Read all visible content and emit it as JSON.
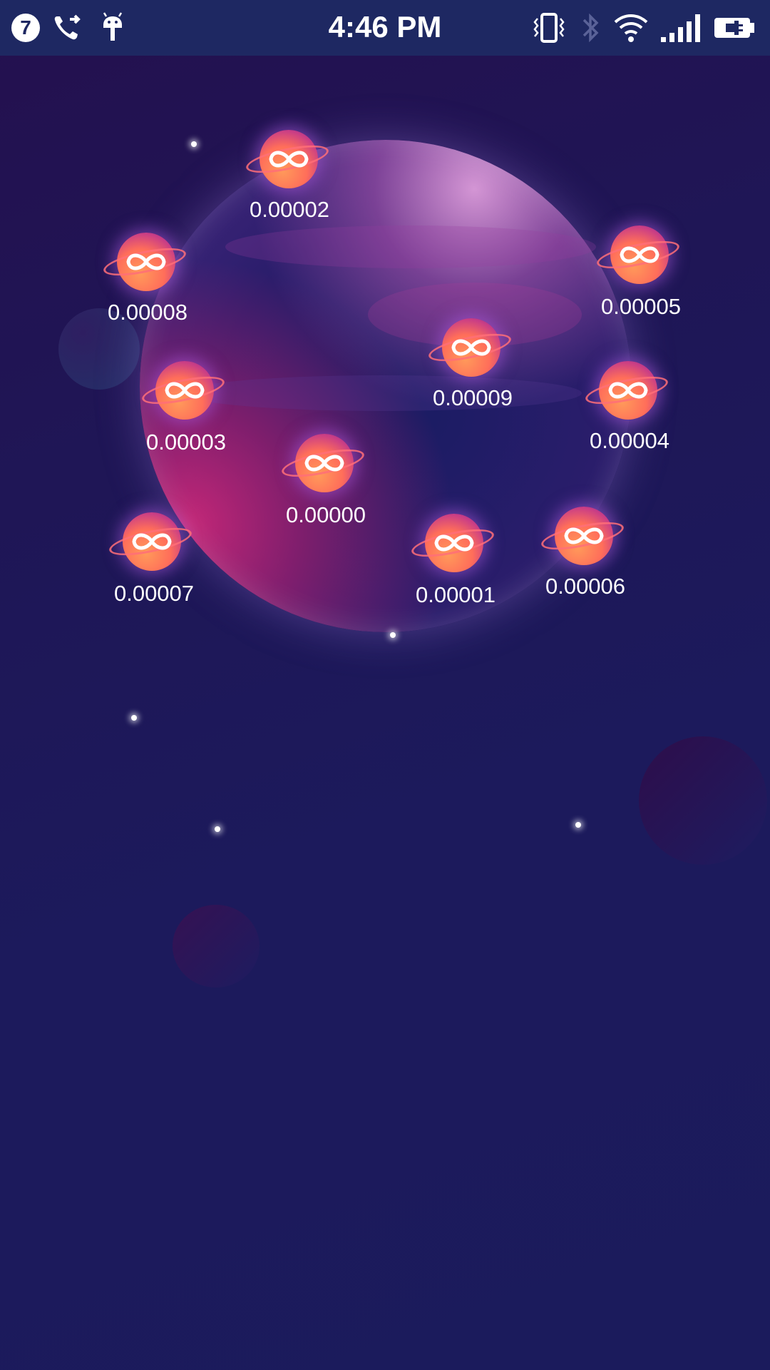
{
  "status_bar": {
    "notification_count": "7",
    "time": "4:46 PM",
    "icons": [
      "notification-count-badge",
      "call-forward-icon",
      "android-debug-icon",
      "vibrate-icon",
      "bluetooth-icon",
      "wifi-icon",
      "signal-icon",
      "battery-charging-icon"
    ]
  },
  "coins": [
    {
      "value": "0.00002"
    },
    {
      "value": "0.00008"
    },
    {
      "value": "0.00005"
    },
    {
      "value": "0.00009"
    },
    {
      "value": "0.00003"
    },
    {
      "value": "0.00004"
    },
    {
      "value": "0.00000"
    },
    {
      "value": "0.00007"
    },
    {
      "value": "0.00001"
    },
    {
      "value": "0.00006"
    }
  ],
  "colors": {
    "status_bar_bg": "#1e2862",
    "background": "#1f1656",
    "coin_orange": "#ff7a5a",
    "coin_purple": "#6b2c96"
  }
}
